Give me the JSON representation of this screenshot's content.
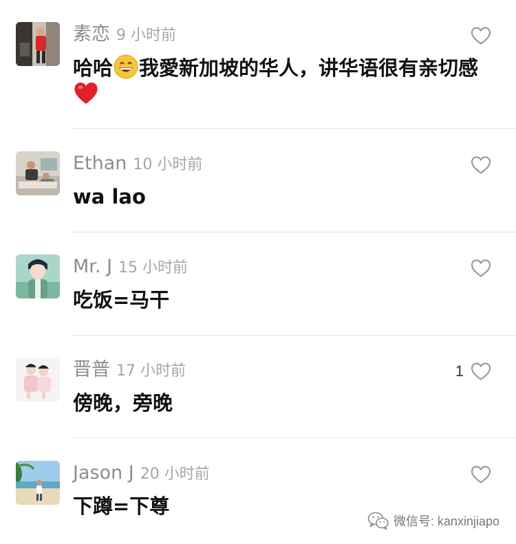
{
  "comments": [
    {
      "username": "素恋",
      "timestamp": "9 小时前",
      "text_before": "哈哈",
      "emoji1": "grinning-face-emoji",
      "text_middle": "我愛新加坡的华人，讲华语很有亲切感",
      "emoji2": "red-heart-emoji",
      "like_count": ""
    },
    {
      "username": "Ethan",
      "timestamp": "10 小时前",
      "text": "wa lao",
      "like_count": ""
    },
    {
      "username": "Mr. J",
      "timestamp": "15 小时前",
      "text": "吃饭=马干",
      "like_count": ""
    },
    {
      "username": "晋普",
      "timestamp": "17 小时前",
      "text": "傍晚，旁晚",
      "like_count": "1"
    },
    {
      "username": "Jason J",
      "timestamp": "20 小时前",
      "text": "下蹲=下尊",
      "like_count": ""
    }
  ],
  "watermark": {
    "text": "微信号: kanxinjiapo",
    "icon": "wechat-icon"
  },
  "colors": {
    "username": "#8d8d8d",
    "timestamp": "#a5a5a5",
    "body_text": "#111111",
    "divider": "#e2e2e2",
    "heart_outline": "#9a9a9a",
    "emoji_heart": "#e0202a",
    "emoji_face": "#f7c43a"
  }
}
